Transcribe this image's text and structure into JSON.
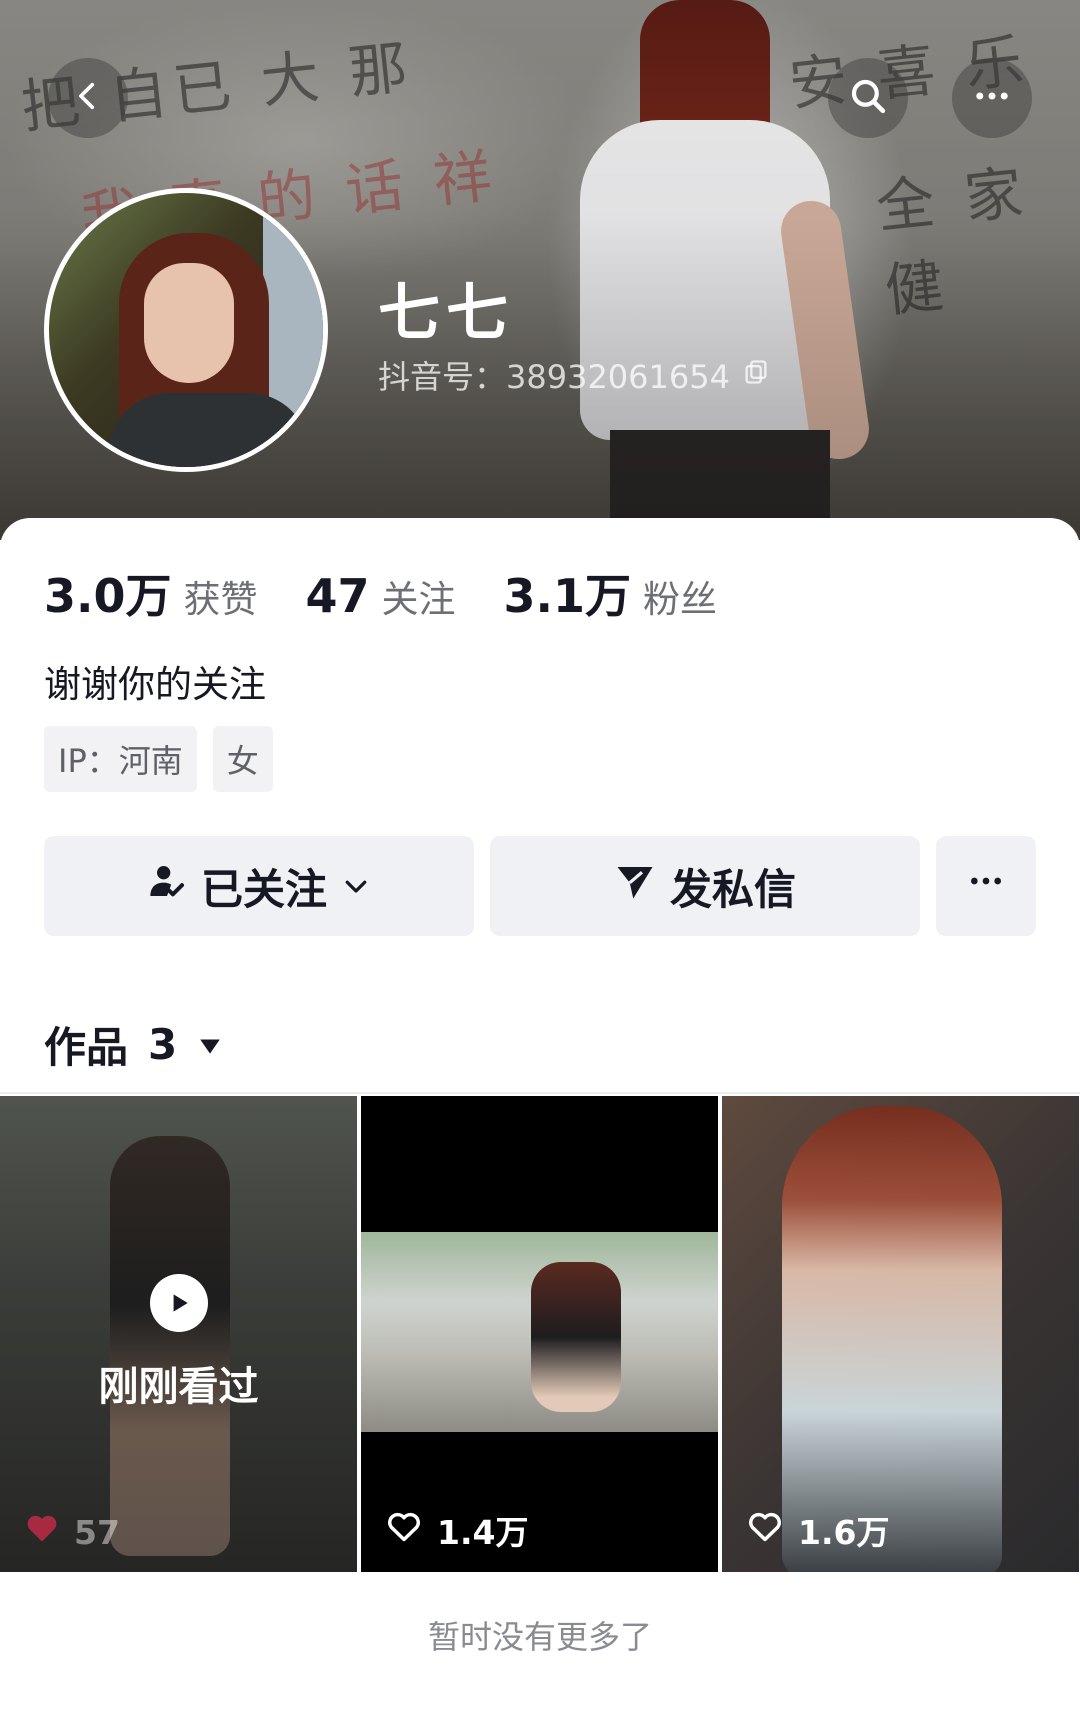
{
  "profile": {
    "nickname": "七七",
    "douyin_id": "抖音号：38932061654",
    "bio": "谢谢你的关注",
    "tags": [
      "IP：河南",
      "女"
    ]
  },
  "stats": [
    {
      "value": "3.0万",
      "label": "获赞"
    },
    {
      "value": "47",
      "label": "关注"
    },
    {
      "value": "3.1万",
      "label": "粉丝"
    }
  ],
  "actions": {
    "follow_label": "已关注",
    "message_label": "发私信"
  },
  "works_tab": {
    "label": "作品",
    "count": "3"
  },
  "videos": [
    {
      "overlay": "刚刚看过",
      "likes": "57"
    },
    {
      "likes": "1.4万"
    },
    {
      "likes": "1.6万"
    }
  ],
  "footer": {
    "no_more": "暂时没有更多了"
  },
  "colors": {
    "text_primary": "#161823",
    "text_secondary": "#6e6f76",
    "button_bg": "#f0f1f4",
    "liked_red": "#fe2c55"
  },
  "icons": [
    "back-icon",
    "search-icon",
    "more-icon",
    "copy-icon",
    "follow-user-icon",
    "chevron-down-icon",
    "send-icon",
    "play-icon",
    "heart-icon",
    "caret-down-icon"
  ]
}
